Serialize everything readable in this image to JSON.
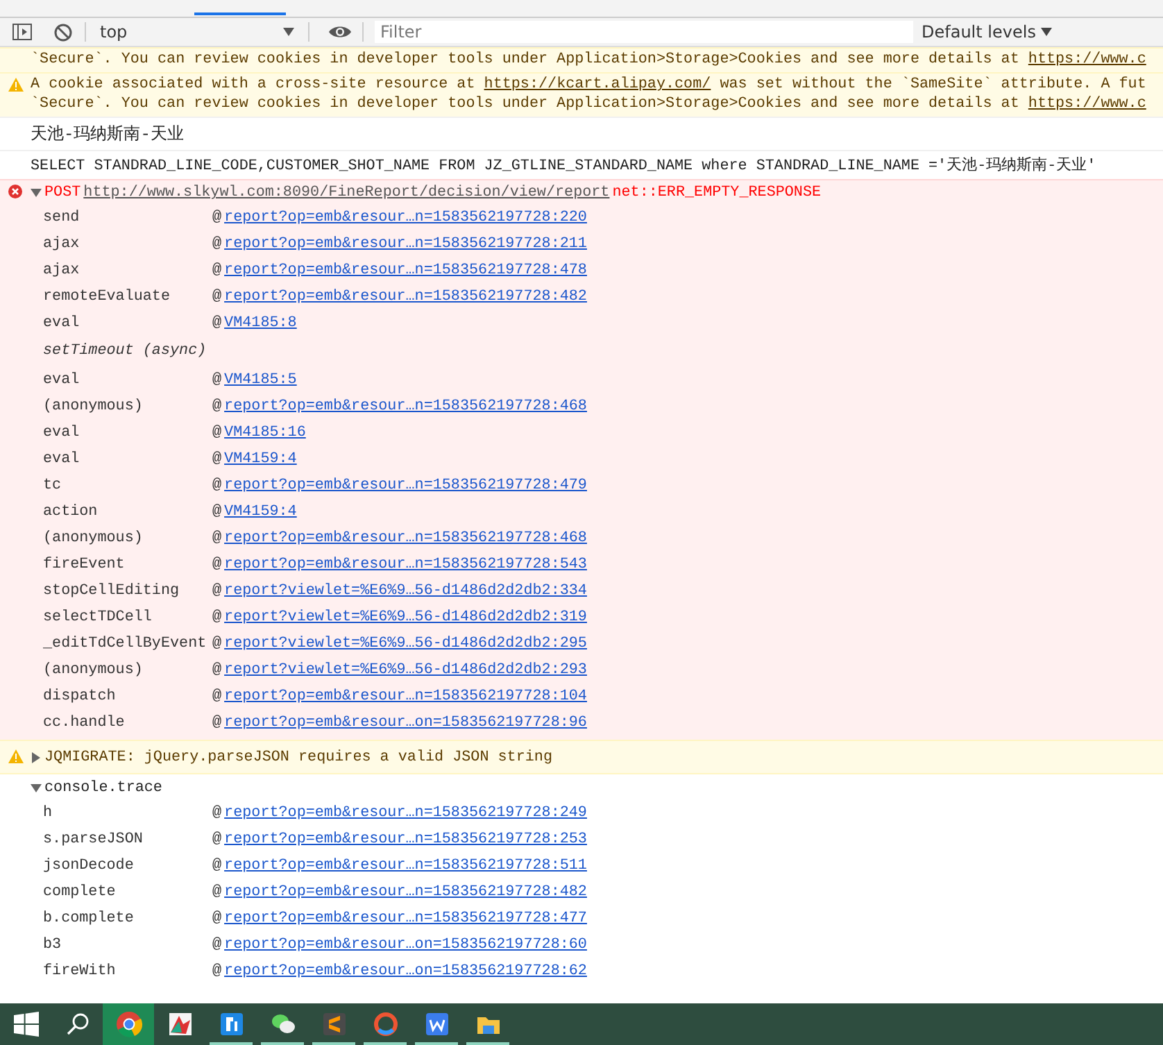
{
  "toolbar": {
    "context": "top",
    "filter_placeholder": "Filter",
    "levels": "Default levels"
  },
  "messages": [
    {
      "kind": "warning",
      "continued": true,
      "lines": [
        [
          {
            "text": "`Secure`. You can review cookies in developer tools under Application>Storage>Cookies and see more details at ",
            "link": false
          },
          {
            "text": "https://www.c",
            "link": true
          }
        ]
      ]
    },
    {
      "kind": "warning",
      "continued": false,
      "lines": [
        [
          {
            "text": "A cookie associated with a cross-site resource at ",
            "link": false
          },
          {
            "text": "https://kcart.alipay.com/",
            "link": true
          },
          {
            "text": " was set without the `SameSite` attribute. A fut",
            "link": false
          }
        ],
        [
          {
            "text": "`Secure`. You can review cookies in developer tools under Application>Storage>Cookies and see more details at ",
            "link": false
          },
          {
            "text": "https://www.c",
            "link": true
          }
        ]
      ]
    },
    {
      "kind": "log",
      "text": "天池-玛纳斯南-天业"
    },
    {
      "kind": "log",
      "text": "SELECT STANDRAD_LINE_CODE,CUSTOMER_SHOT_NAME FROM JZ_GTLINE_STANDARD_NAME where STANDRAD_LINE_NAME ='天池-玛纳斯南-天业'"
    },
    {
      "kind": "error",
      "expanded": true,
      "method": "POST",
      "url": "http://www.slkywl.com:8090/FineReport/decision/view/report",
      "error": "net::ERR_EMPTY_RESPONSE",
      "frames": [
        {
          "kind": "call",
          "fn": "send",
          "at": "@",
          "link": "report?op=emb&resour…n=1583562197728:220"
        },
        {
          "kind": "call",
          "fn": "ajax",
          "at": "@",
          "link": "report?op=emb&resour…n=1583562197728:211"
        },
        {
          "kind": "call",
          "fn": "ajax",
          "at": "@",
          "link": "report?op=emb&resour…n=1583562197728:478"
        },
        {
          "kind": "call",
          "fn": "remoteEvaluate",
          "at": "@",
          "link": "report?op=emb&resour…n=1583562197728:482"
        },
        {
          "kind": "call",
          "fn": "eval",
          "at": "@",
          "link": "VM4185:8"
        },
        {
          "kind": "async",
          "fn": "setTimeout (async)"
        },
        {
          "kind": "call",
          "fn": "eval",
          "at": "@",
          "link": "VM4185:5"
        },
        {
          "kind": "call",
          "fn": "(anonymous)",
          "at": "@",
          "link": "report?op=emb&resour…n=1583562197728:468"
        },
        {
          "kind": "call",
          "fn": "eval",
          "at": "@",
          "link": "VM4185:16"
        },
        {
          "kind": "call",
          "fn": "eval",
          "at": "@",
          "link": "VM4159:4"
        },
        {
          "kind": "call",
          "fn": "tc",
          "at": "@",
          "link": "report?op=emb&resour…n=1583562197728:479"
        },
        {
          "kind": "call",
          "fn": "action",
          "at": "@",
          "link": "VM4159:4"
        },
        {
          "kind": "call",
          "fn": "(anonymous)",
          "at": "@",
          "link": "report?op=emb&resour…n=1583562197728:468"
        },
        {
          "kind": "call",
          "fn": "fireEvent",
          "at": "@",
          "link": "report?op=emb&resour…n=1583562197728:543"
        },
        {
          "kind": "call",
          "fn": "stopCellEditing",
          "at": "@",
          "link": "report?viewlet=%E6%9…56-d1486d2d2db2:334"
        },
        {
          "kind": "call",
          "fn": "selectTDCell",
          "at": "@",
          "link": "report?viewlet=%E6%9…56-d1486d2d2db2:319"
        },
        {
          "kind": "call",
          "fn": "_editTdCellByEvent",
          "at": "@",
          "link": "report?viewlet=%E6%9…56-d1486d2d2db2:295"
        },
        {
          "kind": "call",
          "fn": "(anonymous)",
          "at": "@",
          "link": "report?viewlet=%E6%9…56-d1486d2d2db2:293"
        },
        {
          "kind": "call",
          "fn": "dispatch",
          "at": "@",
          "link": "report?op=emb&resour…n=1583562197728:104"
        },
        {
          "kind": "call",
          "fn": "cc.handle",
          "at": "@",
          "link": "report?op=emb&resour…on=1583562197728:96"
        }
      ]
    },
    {
      "kind": "warning_group",
      "expanded": false,
      "text": "JQMIGRATE: jQuery.parseJSON requires a valid JSON string"
    },
    {
      "kind": "trace",
      "expanded": true,
      "label": "console.trace",
      "frames": [
        {
          "kind": "call",
          "fn": "h",
          "at": "@",
          "link": "report?op=emb&resour…n=1583562197728:249"
        },
        {
          "kind": "call",
          "fn": "s.parseJSON",
          "at": "@",
          "link": "report?op=emb&resour…n=1583562197728:253"
        },
        {
          "kind": "call",
          "fn": "jsonDecode",
          "at": "@",
          "link": "report?op=emb&resour…n=1583562197728:511"
        },
        {
          "kind": "call",
          "fn": "complete",
          "at": "@",
          "link": "report?op=emb&resour…n=1583562197728:482"
        },
        {
          "kind": "call",
          "fn": "b.complete",
          "at": "@",
          "link": "report?op=emb&resour…n=1583562197728:477"
        },
        {
          "kind": "call",
          "fn": "b3",
          "at": "@",
          "link": "report?op=emb&resour…on=1583562197728:60"
        },
        {
          "kind": "call",
          "fn": "fireWith",
          "at": "@",
          "link": "report?op=emb&resour…on=1583562197728:62"
        }
      ]
    }
  ],
  "taskbar": {
    "apps": [
      {
        "kind": "browser",
        "selected": true,
        "running": false
      },
      {
        "kind": "chart",
        "selected": false,
        "running": false
      },
      {
        "kind": "editor",
        "selected": false,
        "running": true
      },
      {
        "kind": "chat",
        "selected": false,
        "running": true
      },
      {
        "kind": "sublime",
        "selected": false,
        "running": true
      },
      {
        "kind": "ring",
        "selected": false,
        "running": true
      },
      {
        "kind": "word",
        "selected": false,
        "running": true
      },
      {
        "kind": "folder",
        "selected": false,
        "running": true
      }
    ]
  }
}
